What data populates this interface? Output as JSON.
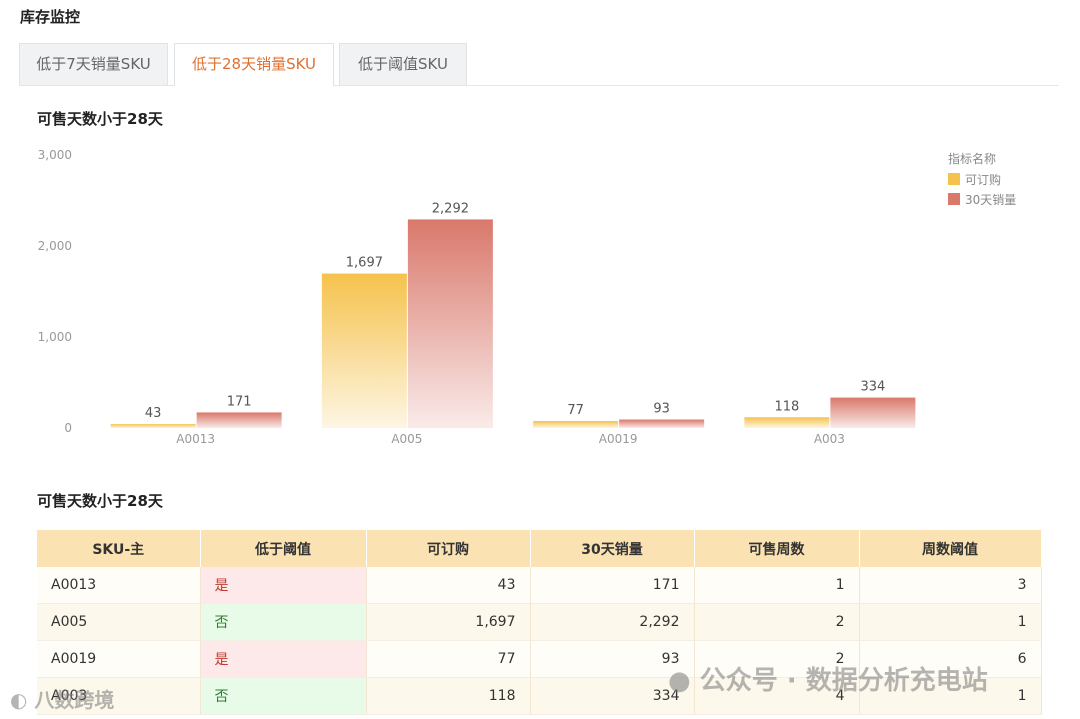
{
  "page": {
    "title": "库存监控"
  },
  "tabs": [
    {
      "label": "低于7天销量SKU",
      "active": false
    },
    {
      "label": "低于28天销量SKU",
      "active": true
    },
    {
      "label": "低于阈值SKU",
      "active": false
    }
  ],
  "chart_section": {
    "title": "可售天数小于28天"
  },
  "table_section": {
    "title": "可售天数小于28天"
  },
  "colors": {
    "series1": "#f5c24c",
    "series2": "#d9786b",
    "axis_text": "#999999",
    "label_text": "#555555"
  },
  "chart_data": {
    "type": "bar",
    "title": "",
    "xlabel": "",
    "ylabel": "",
    "categories": [
      "A0013",
      "A005",
      "A0019",
      "A003"
    ],
    "series": [
      {
        "name": "可订购",
        "values": [
          43,
          1697,
          77,
          118
        ],
        "labels": [
          "43",
          "1,697",
          "77",
          "118"
        ]
      },
      {
        "name": "30天销量",
        "values": [
          171,
          2292,
          93,
          334
        ],
        "labels": [
          "171",
          "2,292",
          "93",
          "334"
        ]
      }
    ],
    "y_ticks": [
      {
        "value": 0,
        "label": "0"
      },
      {
        "value": 1000,
        "label": "1,000"
      },
      {
        "value": 2000,
        "label": "2,000"
      },
      {
        "value": 3000,
        "label": "3,000"
      }
    ],
    "ylim": [
      0,
      3000
    ],
    "grid": false,
    "legend": {
      "title": "指标名称",
      "position": "top-right"
    }
  },
  "table": {
    "headers": [
      "SKU-主",
      "低于阈值",
      "可订购",
      "30天销量",
      "可售周数",
      "周数阈值"
    ],
    "rows": [
      [
        "A0013",
        "是",
        "43",
        "171",
        "1",
        "3"
      ],
      [
        "A005",
        "否",
        "1,697",
        "2,292",
        "2",
        "1"
      ],
      [
        "A0019",
        "是",
        "77",
        "93",
        "2",
        "6"
      ],
      [
        "A003",
        "否",
        "118",
        "334",
        "4",
        "1"
      ]
    ]
  },
  "watermarks": {
    "right": "公众号 · 数据分析充电站",
    "left": "八数跨境"
  }
}
